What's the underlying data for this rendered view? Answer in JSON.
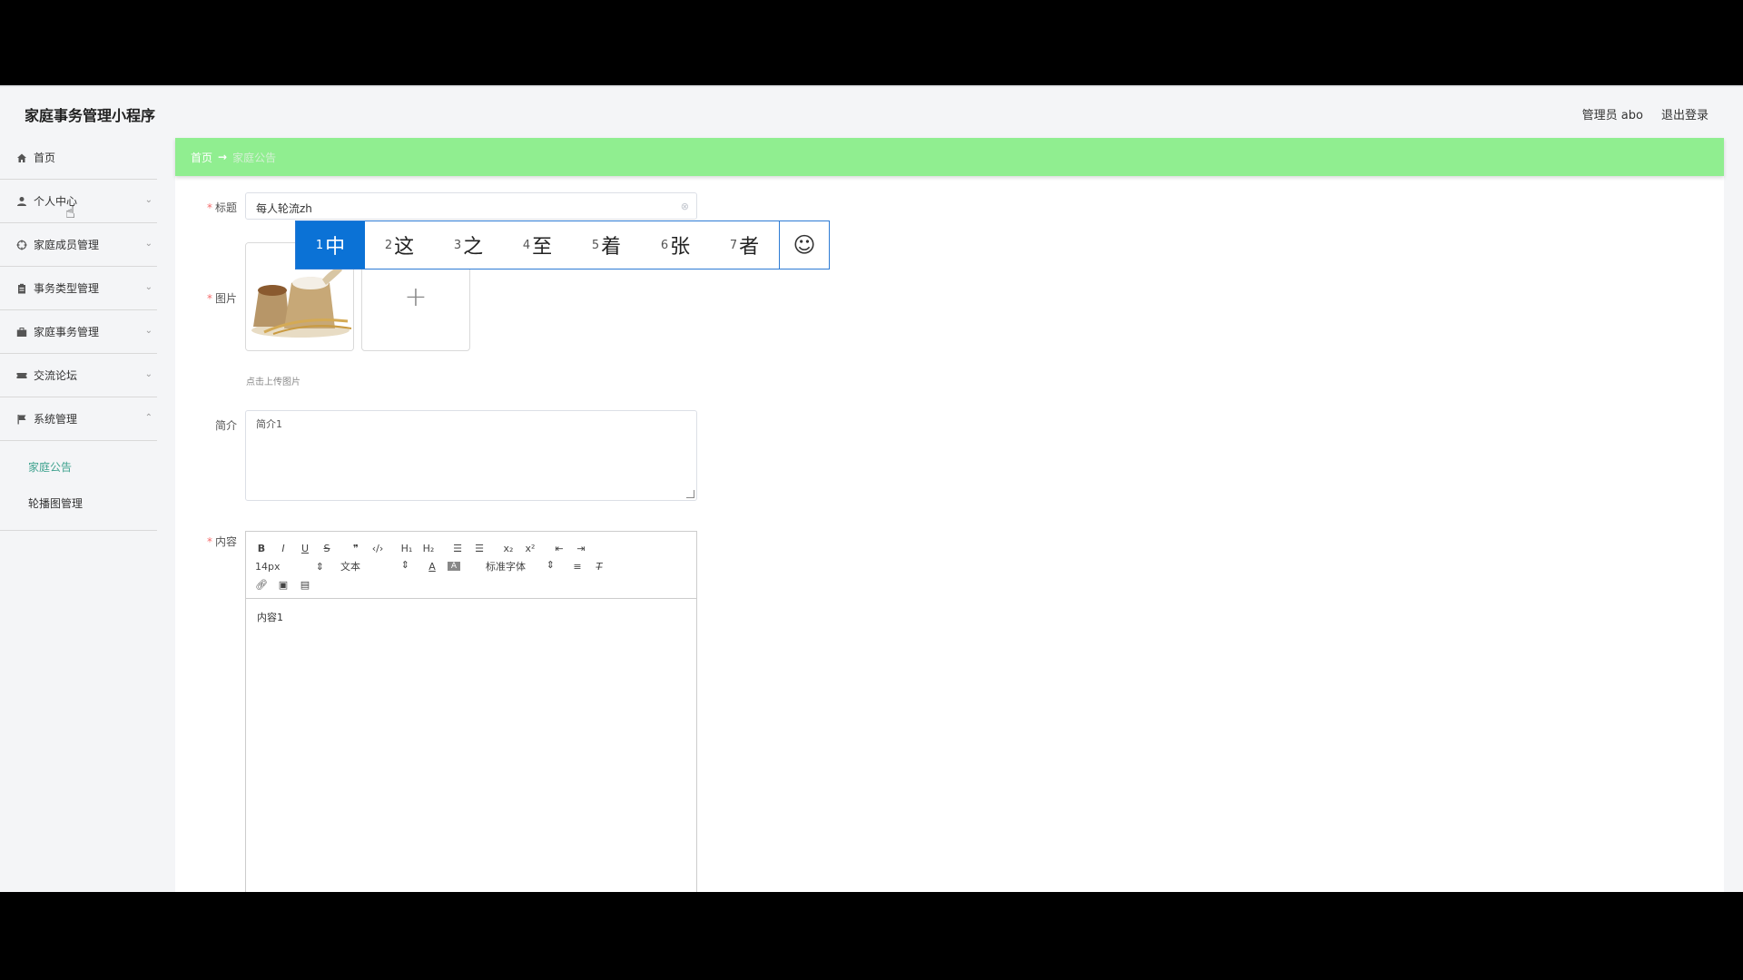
{
  "app": {
    "title": "家庭事务管理小程序"
  },
  "header": {
    "user": "管理员 abo",
    "logout": "退出登录"
  },
  "sidebar": {
    "items": [
      {
        "label": "首页",
        "icon": "home-icon"
      },
      {
        "label": "个人中心",
        "icon": "user-icon"
      },
      {
        "label": "家庭成员管理",
        "icon": "crosshair-icon"
      },
      {
        "label": "事务类型管理",
        "icon": "clipboard-icon"
      },
      {
        "label": "家庭事务管理",
        "icon": "briefcase-icon"
      },
      {
        "label": "交流论坛",
        "icon": "ticket-icon"
      },
      {
        "label": "系统管理",
        "icon": "flag-icon"
      }
    ],
    "sub_items": [
      {
        "label": "家庭公告",
        "active": true
      },
      {
        "label": "轮播图管理",
        "active": false
      }
    ]
  },
  "breadcrumb": {
    "home": "首页",
    "separator": "→",
    "current": "家庭公告"
  },
  "form": {
    "title_label": "标题",
    "title_value": "每人轮流zh",
    "image_label": "图片",
    "upload_hint": "点击上传图片",
    "intro_label": "简介",
    "intro_value": "简介1",
    "content_label": "内容",
    "content_value": "内容1",
    "toolbar": {
      "font_size": "14px",
      "text_style": "文本",
      "font_family": "标准字体",
      "h1": "H₁",
      "h2": "H₂",
      "sub": "x₂",
      "sup": "x²"
    }
  },
  "ime": {
    "candidates": [
      {
        "num": "1",
        "char": "中"
      },
      {
        "num": "2",
        "char": "这"
      },
      {
        "num": "3",
        "char": "之"
      },
      {
        "num": "4",
        "char": "至"
      },
      {
        "num": "5",
        "char": "着"
      },
      {
        "num": "6",
        "char": "张"
      },
      {
        "num": "7",
        "char": "者"
      }
    ],
    "emoji": "☺"
  },
  "colors": {
    "breadcrumb_bg": "#90ee90",
    "active_submenu": "#3fa28f",
    "ime_selected": "#0b72d6"
  }
}
